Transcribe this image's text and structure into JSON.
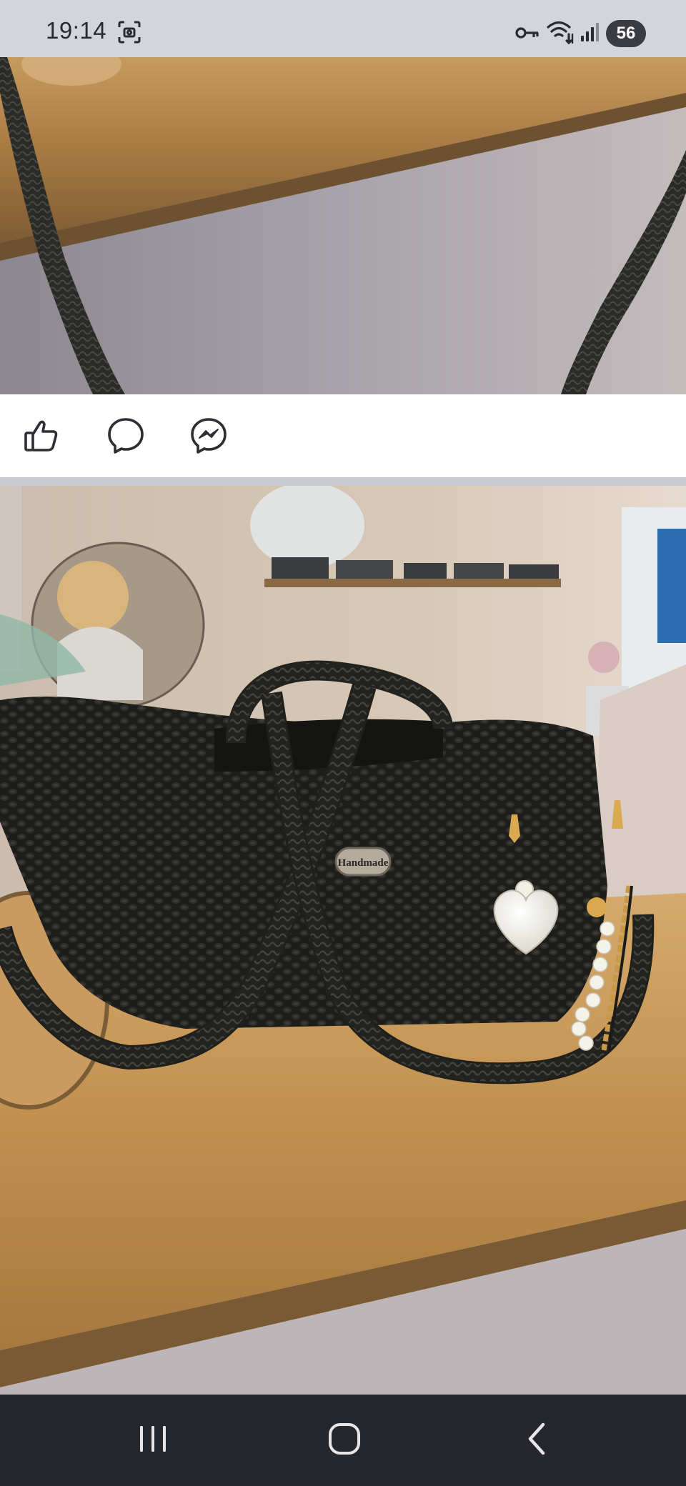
{
  "status_bar": {
    "time": "19:14",
    "battery_level": "56",
    "icons": [
      "screenshot-icon",
      "key-icon",
      "wifi-icon",
      "signal-icon"
    ]
  },
  "post": {
    "images": [
      {
        "name": "post-image-top"
      },
      {
        "name": "post-image-bag"
      }
    ],
    "bag_tag_text": "Handmade",
    "actions": [
      {
        "name": "like-button",
        "icon": "thumbs-up-icon"
      },
      {
        "name": "comment-button",
        "icon": "comment-bubble-icon"
      },
      {
        "name": "messenger-button",
        "icon": "messenger-icon"
      }
    ]
  },
  "navigation": {
    "buttons": [
      {
        "name": "recent-apps-button",
        "icon": "recent-apps-icon"
      },
      {
        "name": "home-button",
        "icon": "home-icon"
      },
      {
        "name": "back-button",
        "icon": "back-icon"
      }
    ]
  },
  "colors": {
    "status_bg": "#d3d5dc",
    "nav_bg": "#26272c",
    "icon_color": "#2d2f36"
  }
}
